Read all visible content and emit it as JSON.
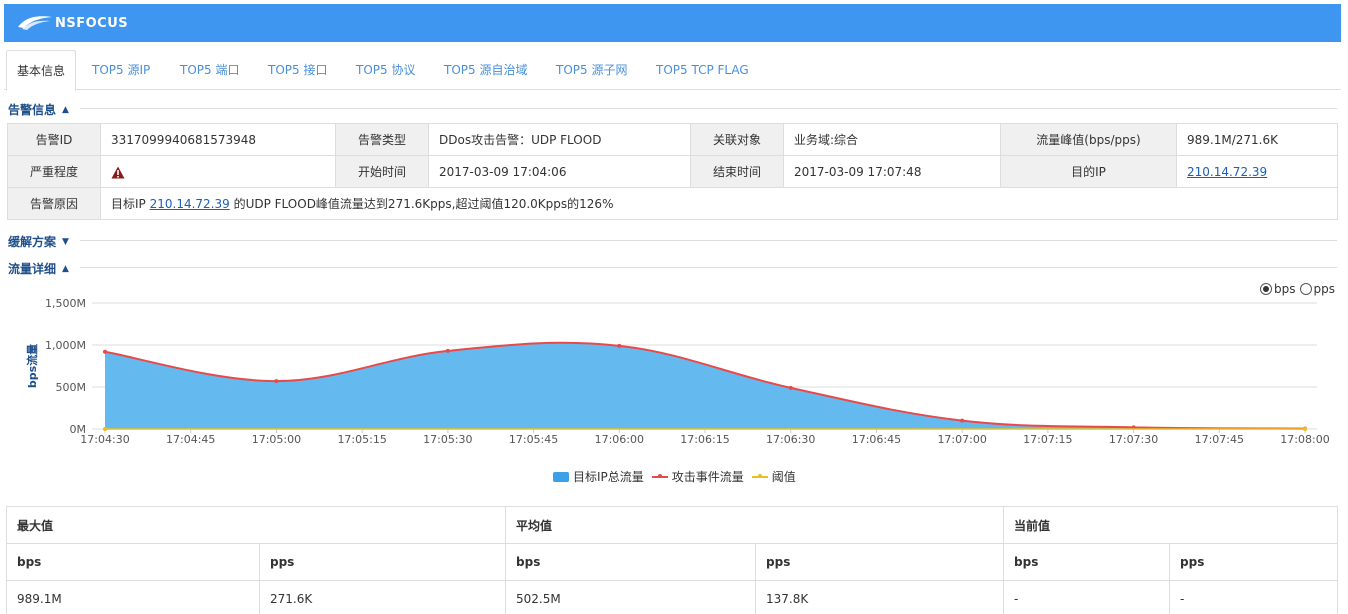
{
  "header": {
    "logo_text": "NSFOCUS",
    "bg_color": "#3e96f0"
  },
  "tabs": [
    {
      "label": "基本信息",
      "active": true
    },
    {
      "label": "TOP5 源IP"
    },
    {
      "label": "TOP5 端口"
    },
    {
      "label": "TOP5 接口"
    },
    {
      "label": "TOP5 协议"
    },
    {
      "label": "TOP5 源自治域"
    },
    {
      "label": "TOP5 源子网"
    },
    {
      "label": "TOP5 TCP FLAG"
    }
  ],
  "sections": {
    "alarm_info": {
      "title": "告警信息",
      "expanded": true
    },
    "mitigation": {
      "title": "缓解方案",
      "expanded": false
    },
    "traffic": {
      "title": "流量详细",
      "expanded": true
    }
  },
  "alarm": {
    "id_label": "告警ID",
    "id_value": "3317099940681573948",
    "type_label": "告警类型",
    "type_value": "DDos攻击告警：UDP FLOOD",
    "related_label": "关联对象",
    "related_value": "业务域:综合",
    "peak_label": "流量峰值(bps/pps)",
    "peak_value": "989.1M/271.6K",
    "severity_label": "严重程度",
    "severity_icon": "warning-triangle-icon",
    "start_label": "开始时间",
    "start_value": "2017-03-09 17:04:06",
    "end_label": "结束时间",
    "end_value": "2017-03-09 17:07:48",
    "target_label": "目的IP",
    "target_value": "210.14.72.39",
    "reason_label": "告警原因",
    "reason_prefix": "目标IP ",
    "reason_ip": "210.14.72.39",
    "reason_suffix": " 的UDP FLOOD峰值流量达到271.6Kpps,超过阈值120.0Kpps的126%"
  },
  "radio": {
    "bps": "bps",
    "pps": "pps",
    "selected": "bps"
  },
  "chart_data": {
    "type": "area",
    "title": "",
    "ylabel": "bps流量",
    "xlabel": "",
    "ylim": [
      0,
      1500
    ],
    "y_ticks": [
      0,
      500,
      1000,
      1500
    ],
    "y_tick_labels": [
      "0M",
      "500M",
      "1,000M",
      "1,500M"
    ],
    "x": [
      "17:04:30",
      "17:04:45",
      "17:05:00",
      "17:05:15",
      "17:05:30",
      "17:05:45",
      "17:06:00",
      "17:06:15",
      "17:06:30",
      "17:06:45",
      "17:07:00",
      "17:07:15",
      "17:07:30",
      "17:07:45",
      "17:08:00"
    ],
    "grid": true,
    "legend_position": "bottom",
    "series": [
      {
        "name": "目标IP总流量",
        "kind": "area",
        "color": "#5cb6ee",
        "x_points": [
          "17:04:30",
          "17:05:00",
          "17:05:30",
          "17:06:00",
          "17:06:30",
          "17:07:00",
          "17:07:30",
          "17:08:00"
        ],
        "values": [
          920,
          570,
          930,
          990,
          490,
          100,
          20,
          5
        ]
      },
      {
        "name": "攻击事件流量",
        "kind": "line",
        "color": "#e84a4a",
        "x_points": [
          "17:04:30",
          "17:05:00",
          "17:05:30",
          "17:06:00",
          "17:06:30",
          "17:07:00",
          "17:07:30",
          "17:08:00"
        ],
        "values": [
          920,
          570,
          930,
          990,
          490,
          100,
          20,
          5
        ]
      },
      {
        "name": "阈值",
        "kind": "line",
        "color": "#e8c020",
        "x_points": [
          "17:04:30",
          "17:08:00"
        ],
        "values": [
          0,
          0
        ]
      }
    ]
  },
  "stats": {
    "max_label": "最大值",
    "avg_label": "平均值",
    "cur_label": "当前值",
    "bps_label": "bps",
    "pps_label": "pps",
    "max_bps": "989.1M",
    "max_pps": "271.6K",
    "avg_bps": "502.5M",
    "avg_pps": "137.8K",
    "cur_bps": "-",
    "cur_pps": "-"
  }
}
